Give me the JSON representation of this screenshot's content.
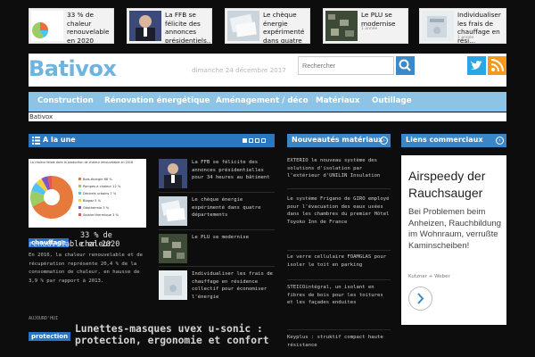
{
  "top_articles": [
    {
      "title": "33 % de chaleur renouvelable en 2020",
      "meta": ""
    },
    {
      "title": "La FFB se félicite des annonces présidentiels...",
      "meta": ""
    },
    {
      "title": "Le chèque énergie expérimenté dans quatre dép...",
      "meta": ""
    },
    {
      "title": "Le PLU se modernise",
      "meta": "1 année"
    },
    {
      "title": "Individualiser les frais de chauffage en rési...",
      "meta": "1 année"
    }
  ],
  "header": {
    "logo": "Bativox",
    "date": "dimanche 24 décembre 2017",
    "search_placeholder": "Rechercher"
  },
  "nav": {
    "items": [
      "Construction",
      "Rénovation énergétique",
      "Aménagement / déco",
      "Matériaux",
      "Outillage"
    ]
  },
  "breadcrumb": "Bativox",
  "a_la_une": {
    "heading": "A la une",
    "feature": {
      "tag": "chauffage",
      "title": "33 % de chaleur renouvelable en 2020",
      "text": "En 2016, la chaleur renouvelable et de récupération représente 20,4 % de la consommation de chaleur, en hausse de 3,9 % par rapport à 2013."
    },
    "side_items": [
      "La FFB se félicite des annonces présidentielles pour 34 heures au bâtiment",
      "Le chèque énergie expérimenté dans quatre départements",
      "Le PLU se modernise",
      "Individualiser les frais de chauffage en résidence collectif pour économiser l'énergie"
    ],
    "second": {
      "date": "AUJOURD'HUI",
      "tag": "protection",
      "title": "Lunettes-masques uvex u-sonic : protection, ergonomie et confort"
    }
  },
  "materiaux": {
    "heading": "Nouveautés matériaux",
    "items": [
      "EXTERIO le nouveau système des solutions d'isolation par l'extérieur d'UNILIN Insulation",
      "Le système Frigano de GIRO employé pour l'évacuation des eaux usées dans les chambres du premier Hôtel Toyoko Inn de France",
      "Le verre cellulaire FOAMGLAS pour isoler le toit en parking",
      "STEICOintégral, un isolant en fibres de bois pour les toitures et les façades enduites",
      "Keyplus : struktif compact haute résistance"
    ]
  },
  "commerciaux": {
    "heading": "Liens commerciaux",
    "ad_title": "Airspeedy der Rauchsauger",
    "ad_text": "Bei Problemen beim Anheizen, Rauchbildung im Wohnraum, verrußte Kaminscheiben!",
    "ad_brand": "Kutzner + Weber"
  },
  "chart_data": {
    "type": "pie",
    "title": "La chaleur fatale dans la production de chaleur renouvelable en 2016",
    "categories": [
      "Bois-énergie",
      "Pompes à chaleur",
      "Déchets urbains",
      "Biogaz",
      "Géothermie",
      "Solaire thermique"
    ],
    "values": [
      68,
      12,
      7,
      5,
      5,
      3
    ]
  },
  "colors": {
    "accent": "#2b77c0",
    "nav": "#8dc4e6",
    "logo": "#6fb3df",
    "twitter": "#29a6e5",
    "rss": "#f39a1e"
  }
}
